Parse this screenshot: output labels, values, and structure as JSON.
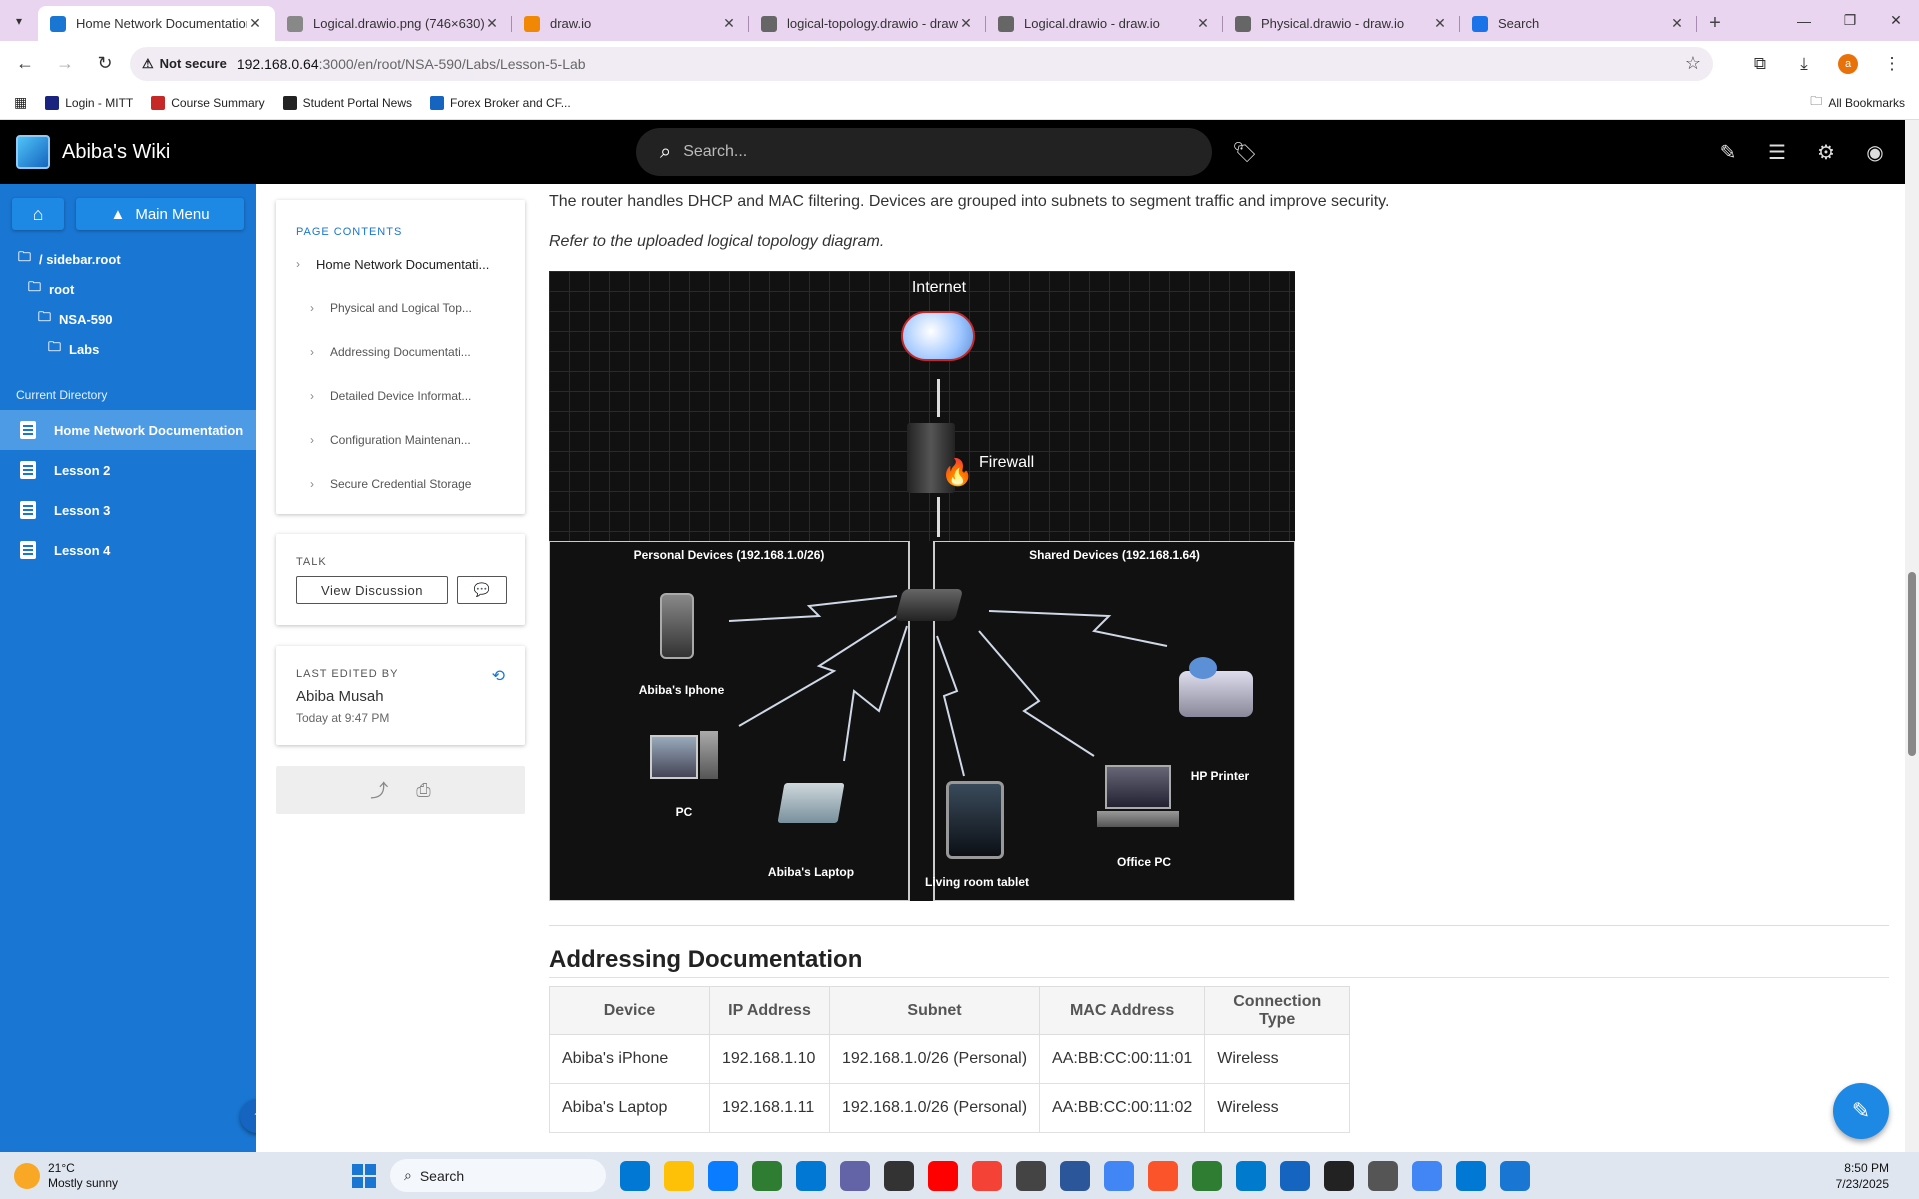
{
  "browser": {
    "tabs": [
      {
        "title": "Home Network Documentation",
        "favicon_color": "#1976d2",
        "active": true
      },
      {
        "title": "Logical.drawio.png (746×630)",
        "favicon_color": "#888888",
        "active": false
      },
      {
        "title": "draw.io",
        "favicon_color": "#f08705",
        "active": false
      },
      {
        "title": "logical-topology.drawio - draw.io",
        "favicon_color": "#666666",
        "active": false
      },
      {
        "title": "Logical.drawio - draw.io",
        "favicon_color": "#666666",
        "active": false
      },
      {
        "title": "Physical.drawio - draw.io",
        "favicon_color": "#666666",
        "active": false
      },
      {
        "title": "Search",
        "favicon_color": "#1a73e8",
        "active": false
      }
    ],
    "not_secure": "Not secure",
    "url_host": "192.168.0.64",
    "url_path": ":3000/en/root/NSA-590/Labs/Lesson-5-Lab",
    "profile_initial": "a",
    "bookmarks": [
      {
        "label": "Login - MITT",
        "color": "#1a237e"
      },
      {
        "label": "Course Summary",
        "color": "#c62828"
      },
      {
        "label": "Student Portal News",
        "color": "#222222"
      },
      {
        "label": "Forex Broker and CF...",
        "color": "#1565c0"
      }
    ],
    "all_bookmarks": "All Bookmarks"
  },
  "header": {
    "title": "Abiba's Wiki",
    "search_placeholder": "Search..."
  },
  "sidebar": {
    "main_menu": "Main Menu",
    "tree": [
      {
        "label": "/ sidebar.root",
        "indent": 0
      },
      {
        "label": "root",
        "indent": 1
      },
      {
        "label": "NSA-590",
        "indent": 2
      },
      {
        "label": "Labs",
        "indent": 3
      }
    ],
    "current_directory": "Current Directory",
    "pages": [
      {
        "label": "Home Network Documentation",
        "active": true
      },
      {
        "label": "Lesson 2",
        "active": false
      },
      {
        "label": "Lesson 3",
        "active": false
      },
      {
        "label": "Lesson 4",
        "active": false
      }
    ]
  },
  "toc": {
    "title": "PAGE CONTENTS",
    "items": [
      {
        "label": "Home Network Documentati...",
        "level": 1
      },
      {
        "label": "Physical and Logical Top...",
        "level": 2
      },
      {
        "label": "Addressing Documentati...",
        "level": 2
      },
      {
        "label": "Detailed Device Informat...",
        "level": 2
      },
      {
        "label": "Configuration Maintenan...",
        "level": 2
      },
      {
        "label": "Secure Credential Storage",
        "level": 2
      }
    ]
  },
  "talk": {
    "title": "TALK",
    "view_discussion": "View Discussion"
  },
  "last_edited": {
    "title": "LAST EDITED BY",
    "author": "Abiba Musah",
    "when": "Today at 9:47 PM"
  },
  "article": {
    "intro": "The router handles DHCP and MAC filtering. Devices are grouped into subnets to segment traffic and improve security.",
    "note": "Refer to the uploaded logical topology diagram.",
    "diagram": {
      "internet": "Internet",
      "firewall": "Firewall",
      "zone_personal": "Personal Devices (192.168.1.0/26)",
      "zone_shared": "Shared Devices (192.168.1.64)",
      "iphone": "Abiba's Iphone",
      "pc": "PC",
      "laptop": "Abiba's Laptop",
      "tablet": "Living room tablet",
      "office_pc": "Office PC",
      "printer": "HP Printer"
    },
    "section_title": "Addressing Documentation",
    "table": {
      "headers": [
        "Device",
        "IP Address",
        "Subnet",
        "MAC Address",
        "Connection Type"
      ],
      "rows": [
        [
          "Abiba's iPhone",
          "192.168.1.10",
          "192.168.1.0/26 (Personal)",
          "AA:BB:CC:00:11:01",
          "Wireless"
        ],
        [
          "Abiba's Laptop",
          "192.168.1.11",
          "192.168.1.0/26 (Personal)",
          "AA:BB:CC:00:11:02",
          "Wireless"
        ]
      ]
    }
  },
  "taskbar": {
    "temp": "21°C",
    "weather": "Mostly sunny",
    "search": "Search",
    "time": "8:50 PM",
    "date": "7/23/2025",
    "apps": [
      "#0078d4",
      "#ffc107",
      "#0a7cff",
      "#2e7d32",
      "#0078d4",
      "#6264a7",
      "#333333",
      "#ff0000",
      "#f44336",
      "#444444",
      "#2b579a",
      "#4285f4",
      "#fb542b",
      "#2e7d32",
      "#007acc",
      "#1565c0",
      "#222222",
      "#555555",
      "#4285f4",
      "#0078d4",
      "#1976d2"
    ]
  }
}
